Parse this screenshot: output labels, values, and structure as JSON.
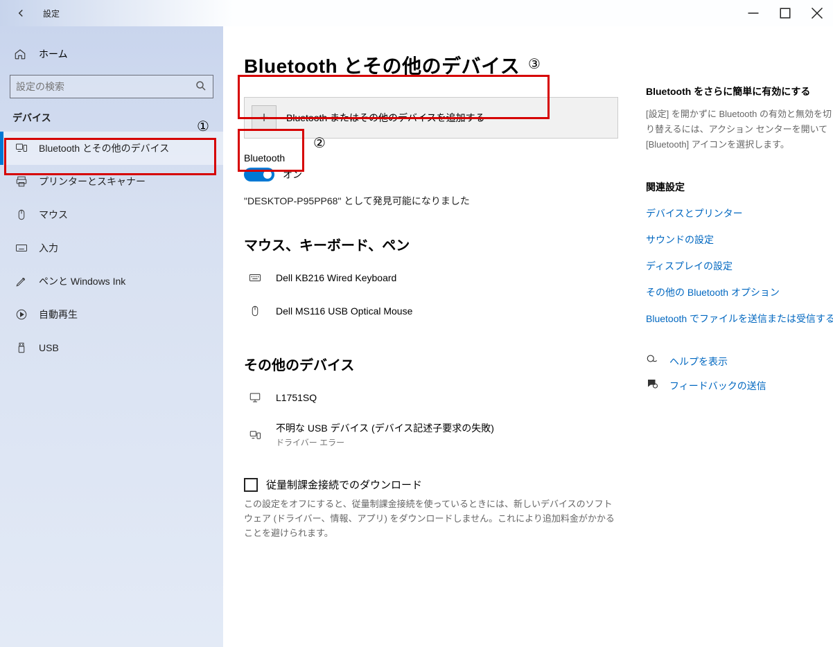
{
  "window": {
    "title": "設定"
  },
  "sidebar": {
    "home": "ホーム",
    "searchPlaceholder": "設定の検索",
    "category": "デバイス",
    "items": [
      {
        "label": "Bluetooth とその他のデバイス"
      },
      {
        "label": "プリンターとスキャナー"
      },
      {
        "label": "マウス"
      },
      {
        "label": "入力"
      },
      {
        "label": "ペンと Windows Ink"
      },
      {
        "label": "自動再生"
      },
      {
        "label": "USB"
      }
    ]
  },
  "page": {
    "title": "Bluetooth とその他のデバイス",
    "addDevice": "Bluetooth またはその他のデバイスを追加する",
    "btLabel": "Bluetooth",
    "btState": "オン",
    "discoverable": "\"DESKTOP-P95PP68\" として発見可能になりました",
    "group1": "マウス、キーボード、ペン",
    "dev1": {
      "name": "Dell KB216 Wired Keyboard"
    },
    "dev2": {
      "name": "Dell MS116 USB Optical Mouse"
    },
    "group2": "その他のデバイス",
    "dev3": {
      "name": "L1751SQ"
    },
    "dev4": {
      "name": "不明な USB デバイス (デバイス記述子要求の失敗)",
      "sub": "ドライバー エラー"
    },
    "metered": {
      "label": "従量制課金接続でのダウンロード",
      "desc": "この設定をオフにすると、従量制課金接続を使っているときには、新しいデバイスのソフトウェア (ドライバー、情報、アプリ) をダウンロードしません。これにより追加料金がかかることを避けられます。"
    }
  },
  "right": {
    "tipTitle": "Bluetooth をさらに簡単に有効にする",
    "tipDesc": "[設定] を開かずに Bluetooth の有効と無効を切り替えるには、アクション センターを開いて [Bluetooth] アイコンを選択します。",
    "relatedTitle": "関連設定",
    "links": [
      "デバイスとプリンター",
      "サウンドの設定",
      "ディスプレイの設定",
      "その他の Bluetooth オプション",
      "Bluetooth でファイルを送信または受信する"
    ],
    "help": "ヘルプを表示",
    "feedback": "フィードバックの送信"
  },
  "annotations": {
    "n1": "①",
    "n2": "②",
    "n3": "③"
  }
}
